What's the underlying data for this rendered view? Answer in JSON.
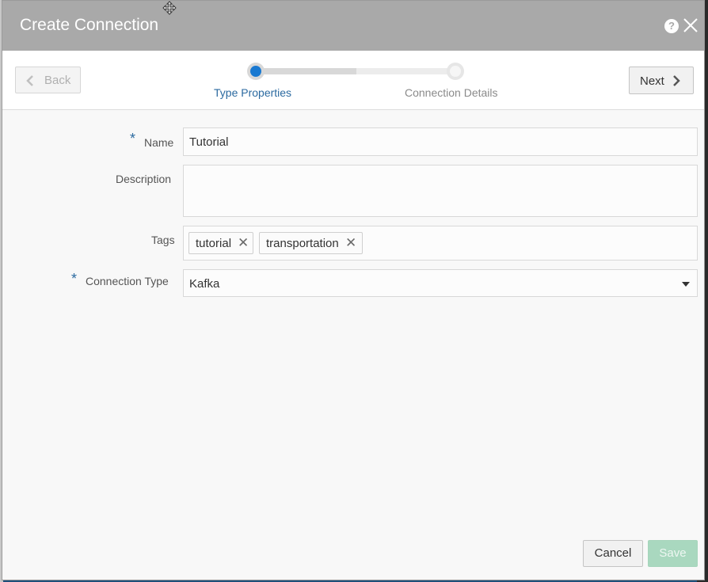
{
  "dialog": {
    "title": "Create Connection",
    "help_icon": "?"
  },
  "train": {
    "back_label": "Back",
    "next_label": "Next",
    "steps": [
      {
        "label": "Type Properties",
        "state": "current"
      },
      {
        "label": "Connection Details",
        "state": "pending"
      }
    ]
  },
  "form": {
    "name": {
      "label": "Name",
      "required_mark": "*",
      "value": "Tutorial"
    },
    "description": {
      "label": "Description",
      "value": ""
    },
    "tags": {
      "label": "Tags",
      "items": [
        "tutorial",
        "transportation"
      ],
      "remove_glyph": "✕"
    },
    "connection_type": {
      "label": "Connection Type",
      "required_mark": "*",
      "value": "Kafka"
    }
  },
  "footer": {
    "cancel_label": "Cancel",
    "save_label": "Save"
  },
  "colors": {
    "titlebar": "#a9a9a9",
    "accent": "#1979d1",
    "save_disabled": "#a9d8bf"
  }
}
